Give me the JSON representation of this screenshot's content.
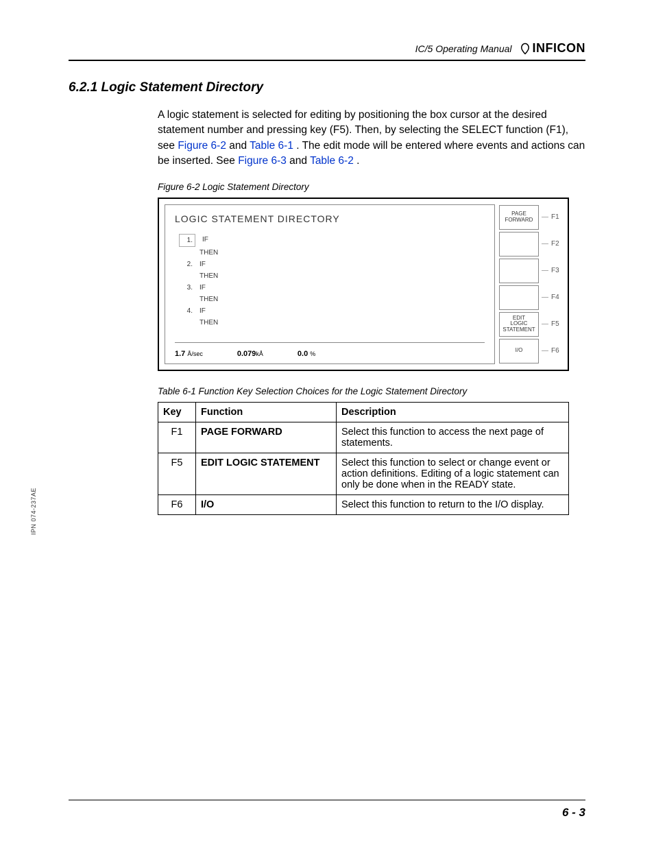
{
  "header": {
    "manual_title": "IC/5 Operating Manual",
    "brand": "INFICON"
  },
  "section": {
    "number": "6.2.1",
    "title": "Logic Statement Directory"
  },
  "paragraph": {
    "part1": "A logic statement is selected for editing by positioning the box cursor at the desired statement number and pressing key (F5). Then, by selecting the SELECT function (F1), see ",
    "link1": "Figure 6-2",
    "part2": " and ",
    "link2": "Table 6-1",
    "part3": ". The edit mode will be entered where events and actions can be inserted. See ",
    "link3": "Figure 6-3",
    "part4": " and ",
    "link4": "Table 6-2",
    "part5": "."
  },
  "figure": {
    "caption": "Figure 6-2  Logic Statement Directory",
    "screen_title": "LOGIC STATEMENT DIRECTORY",
    "statements": [
      {
        "num": "1.",
        "boxed": true,
        "kw": "IF",
        "then": "THEN"
      },
      {
        "num": "2.",
        "boxed": false,
        "kw": "IF",
        "then": "THEN"
      },
      {
        "num": "3.",
        "boxed": false,
        "kw": "IF",
        "then": "THEN"
      },
      {
        "num": "4.",
        "boxed": false,
        "kw": "IF",
        "then": "THEN"
      }
    ],
    "footer": {
      "rate_val": "1.7",
      "rate_unit": "Å/sec",
      "thick_val": "0.079",
      "thick_unit": "kÅ",
      "pct_val": "0.0",
      "pct_unit": "%"
    },
    "fkeys": [
      {
        "label": "PAGE\nFORWARD",
        "key": "F1"
      },
      {
        "label": "",
        "key": "F2"
      },
      {
        "label": "",
        "key": "F3"
      },
      {
        "label": "",
        "key": "F4"
      },
      {
        "label": "EDIT\nLOGIC\nSTATEMENT",
        "key": "F5"
      },
      {
        "label": "I/O",
        "key": "F6"
      }
    ]
  },
  "table": {
    "caption": "Table 6-1  Function Key Selection Choices for the Logic Statement Directory",
    "headers": {
      "key": "Key",
      "function": "Function",
      "description": "Description"
    },
    "rows": [
      {
        "key": "F1",
        "function": "PAGE FORWARD",
        "description": "Select this function to access the next page of statements."
      },
      {
        "key": "F5",
        "function": "EDIT LOGIC STATEMENT",
        "description": "Select this function to select or change event or action definitions. Editing of a logic statement can only be done when in the READY state."
      },
      {
        "key": "F6",
        "function": "I/O",
        "description": "Select this function to return to the I/O display."
      }
    ]
  },
  "side_note": "IPN 074-237AE",
  "page_number": "6 - 3"
}
